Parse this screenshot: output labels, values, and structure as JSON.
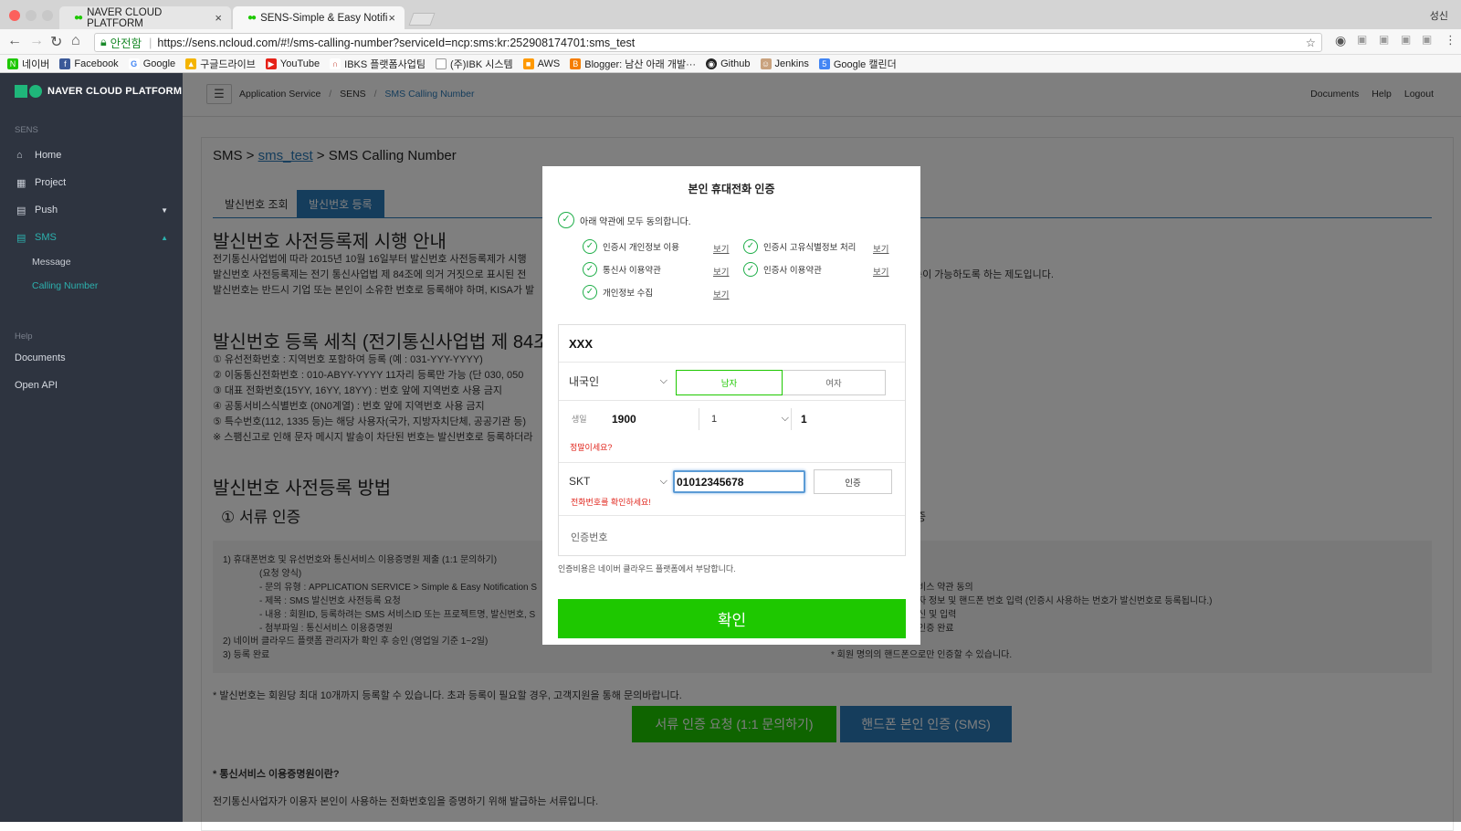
{
  "browser": {
    "tabs": [
      {
        "title": "NAVER CLOUD PLATFORM"
      },
      {
        "title": "SENS-Simple & Easy Notificati"
      }
    ],
    "profile_name": "성신",
    "secure_label": "안전함",
    "url": "https://sens.ncloud.com/#!/sms-calling-number?serviceId=ncp:sms:kr:252908174701:sms_test",
    "bookmarks": [
      "네이버",
      "Facebook",
      "Google",
      "구글드라이브",
      "YouTube",
      "IBKS 플랫폼사업팀",
      "(주)IBK 시스템",
      "AWS",
      "Blogger: 남산 아래 개발···",
      "Github",
      "Jenkins",
      "Google 캘린더"
    ]
  },
  "sidebar": {
    "logo": "NAVER CLOUD PLATFORM",
    "section_sens": "SENS",
    "items": [
      {
        "label": "Home",
        "icon": "home-icon"
      },
      {
        "label": "Project",
        "icon": "grid-icon"
      },
      {
        "label": "Push",
        "icon": "chat-icon"
      },
      {
        "label": "SMS",
        "icon": "chat-icon"
      }
    ],
    "sub_items": [
      "Message",
      "Calling Number"
    ],
    "section_help": "Help",
    "help_items": [
      "Documents",
      "Open API"
    ],
    "colors": {
      "bg": "#2e3440",
      "active": "#2cb1ae"
    }
  },
  "topbar": {
    "crumbs": [
      "Application Service",
      "SENS",
      "SMS Calling Number"
    ],
    "links": [
      "Documents",
      "Help",
      "Logout"
    ]
  },
  "main": {
    "title_prefix": "SMS >",
    "title_link": "sms_test",
    "title_suffix": "> SMS Calling Number",
    "tabs": [
      "발신번호 조회",
      "발신번호 등록"
    ],
    "h1": "발신번호 사전등록제 시행 안내",
    "p1_lines": [
      "전기통신사업법에 따라 2015년 10월 16일부터 발신번호 사전등록제가 시행",
      "발신번호 사전등록제는 전기 통신사업법 제 84조에 의거 거짓으로 표시된 전",
      "발신번호는 반드시 기업 또는 본인이 소유한 번호로 등록해야 하며, KISA가 발"
    ],
    "p1_right": "능이 가능하도록 하는 제도입니다.",
    "h2": "발신번호 등록 세칙 (전기통신사업법 제 84조",
    "rules": [
      "① 유선전화번호 : 지역번호 포함하여 등록 (예 : 031-YYY-YYYY)",
      "② 이동통신전화번호 : 010-ABYY-YYYY 11자리 등록만 가능 (단 030, 050",
      "③ 대표 전화번호(15YY, 16YY, 18YY) : 번호 앞에 지역번호 사용 금지",
      "④ 공통서비스식별번호 (0N0계열) : 번호 앞에 지역번호 사용 금지",
      "⑤ 특수번호(112, 1335 등)는 해당 사용자(국가, 지방자치단체, 공공기관 등)",
      "※ 스팸신고로 인해 문자 메시지 발송이 차단된 번호는 발신번호로 등록하더라"
    ],
    "h3": "발신번호 사전등록 방법",
    "h4": "① 서류 인증",
    "h4_right": "증",
    "doc_left": [
      "1) 휴대폰번호 및 유선번호와 통신서비스 이용증명원 제출 (1:1 문의하기)",
      "(요청 양식)",
      "- 문의 유형 : APPLICATION SERVICE > Simple & Easy Notification S",
      "- 제목 : SMS 발신번호 사전등록 요청",
      "- 내용 : 회원ID, 등록하려는 SMS 서비스ID 또는 프로젝트명, 발신번호, S",
      "- 첨부파일 : 통신서비스 이용증명원",
      "2) 네이버 클라우드 플랫폼 관리자가 확인 후 승인 (영업일 기준 1~2일)",
      "3) 등록 완료"
    ],
    "doc_right": [
      "비스 약관 동의",
      "자 정보 및 핸드폰 번호 입력 (인증시 사용하는 번호가 발신번호로 등록됩니다.)",
      "신 및 입력",
      "인증 완료",
      "* 회원 명의의 핸드폰으로만 인증할 수 있습니다."
    ],
    "note": "* 발신번호는 회원당 최대 10개까지 등록할 수 있습니다. 초과 등록이 필요할 경우, 고객지원을 통해 문의바랍니다.",
    "btn_doc": "서류 인증 요청 (1:1 문의하기)",
    "btn_sms": "핸드폰 본인 인증 (SMS)",
    "footer_q": "* 통신서비스 이용증명원이란?",
    "footer_a": "전기통신사업자가 이용자 본인이 사용하는 전화번호임을 증명하기 위해 발급하는 서류입니다."
  },
  "modal": {
    "title": "본인 휴대전화 인증",
    "agree_all": "아래 약관에 모두 동의합니다.",
    "terms": [
      {
        "label": "인증시 개인정보 이용",
        "link": "보기"
      },
      {
        "label": "인증시 고유식별정보 처리",
        "link": "보기"
      },
      {
        "label": "통신사 이용약관",
        "link": "보기"
      },
      {
        "label": "인증사 이용약관",
        "link": "보기"
      },
      {
        "label": "개인정보 수집",
        "link": "보기"
      }
    ],
    "name_value": "XXX",
    "nationality": "내국인",
    "gender_male": "남자",
    "gender_female": "여자",
    "birth_label": "생일",
    "birth_year": "1900",
    "birth_month": "1",
    "birth_day": "1",
    "birth_error": "정말이세요?",
    "carrier": "SKT",
    "phone_value": "01012345678",
    "phone_error": "전화번호를 확인하세요!",
    "auth_button": "인증",
    "code_placeholder": "인증번호",
    "fee_note": "인증비용은 네이버 클라우드 플랫폼에서 부담합니다.",
    "confirm": "확인",
    "colors": {
      "confirm": "#1ec800",
      "check": "#1fae49",
      "error": "#e0241b"
    }
  }
}
